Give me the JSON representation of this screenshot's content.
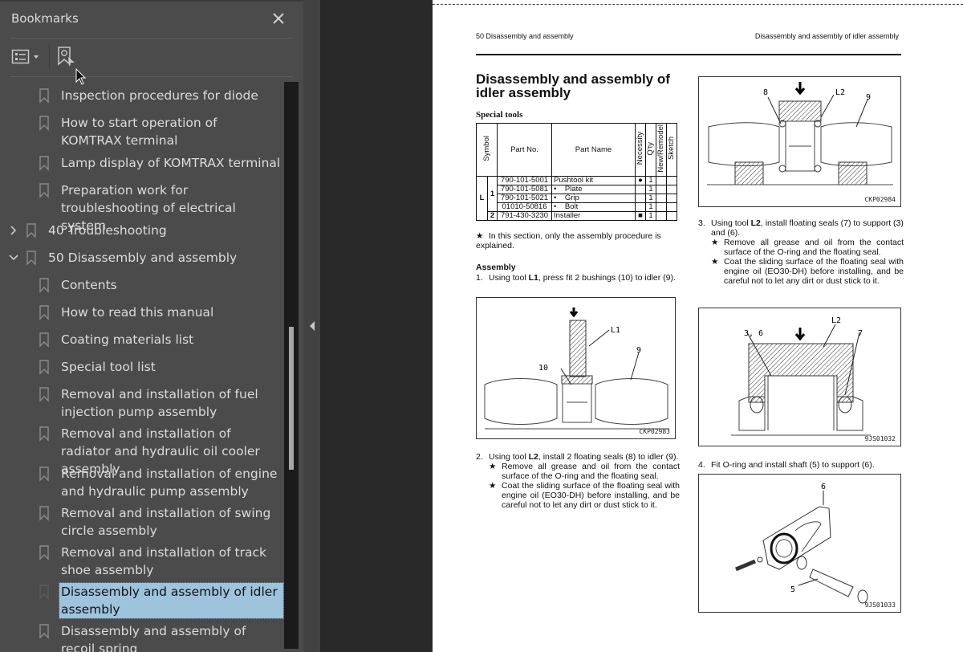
{
  "bookmarks_panel": {
    "title": "Bookmarks",
    "close_icon": "close-icon",
    "toolbar": {
      "options_icon": "list-options-icon",
      "find_icon": "find-current-bookmark-icon"
    },
    "items": [
      {
        "label": "Inspection procedures for diode",
        "level": 2,
        "selected": false
      },
      {
        "label": "How to start operation of KOMTRAX terminal",
        "level": 2,
        "selected": false
      },
      {
        "label": "Lamp display of KOMTRAX terminal",
        "level": 2,
        "selected": false
      },
      {
        "label": "Preparation work for troubleshooting of electrical system",
        "level": 2,
        "selected": false
      },
      {
        "label": "40 Troubleshooting",
        "level": 1,
        "expanded": false,
        "selected": false
      },
      {
        "label": "50 Disassembly and assembly",
        "level": 1,
        "expanded": true,
        "selected": false
      },
      {
        "label": "Contents",
        "level": 2,
        "selected": false
      },
      {
        "label": "How to read this manual",
        "level": 2,
        "selected": false
      },
      {
        "label": "Coating materials list",
        "level": 2,
        "selected": false
      },
      {
        "label": "Special tool list",
        "level": 2,
        "selected": false
      },
      {
        "label": "Removal and installation of fuel injection pump assembly",
        "level": 2,
        "selected": false
      },
      {
        "label": "Removal and installation of radiator and hydraulic oil cooler assembly",
        "level": 2,
        "selected": false
      },
      {
        "label": "Removal and installation of engine and hydraulic pump assembly",
        "level": 2,
        "selected": false
      },
      {
        "label": "Removal and installation of swing circle assembly",
        "level": 2,
        "selected": false
      },
      {
        "label": "Removal and installation of track shoe assembly",
        "level": 2,
        "selected": false
      },
      {
        "label": "Disassembly and assembly of idler assembly",
        "level": 2,
        "selected": true
      },
      {
        "label": "Disassembly and assembly of recoil spring",
        "level": 2,
        "selected": false
      }
    ]
  },
  "document": {
    "header_left": "50 Disassembly and assembly",
    "header_right": "Disassembly and assembly of idler assembly",
    "title": "Disassembly and assembly of idler assembly",
    "special_tools_heading": "Special tools",
    "table": {
      "headers": [
        "Symbol",
        "Part No.",
        "Part Name",
        "Necessity",
        "Q'ty",
        "New/Remodel",
        "Sketch"
      ],
      "rows": [
        {
          "sym": "L",
          "sub": "1",
          "part_no": "790-101-5001",
          "name": "Pushtool kit",
          "necessity": "●",
          "qty": "1"
        },
        {
          "sym": "",
          "sub": "",
          "part_no": "790-101-5081",
          "name": "•    Plate",
          "necessity": "",
          "qty": "1"
        },
        {
          "sym": "",
          "sub": "",
          "part_no": "790-101-5021",
          "name": "•    Grip",
          "necessity": "",
          "qty": "1"
        },
        {
          "sym": "",
          "sub": "",
          "part_no": "01010-50816",
          "name": "•    Bolt",
          "necessity": "",
          "qty": "1"
        },
        {
          "sym": "",
          "sub": "2",
          "part_no": "791-430-3230",
          "name": "Installer",
          "necessity": "■",
          "qty": "1"
        }
      ]
    },
    "note": "In this section, only the assembly procedure is explained.",
    "assembly_heading": "Assembly",
    "steps": [
      {
        "num": "1.",
        "pre": "Using tool ",
        "tool": "L1",
        "post": ", press fit 2 bushings (10) to idler (9).",
        "notes": []
      },
      {
        "num": "2.",
        "pre": "Using tool ",
        "tool": "L2",
        "post": ", install 2 floating seals (8) to idler (9).",
        "notes": [
          "Remove all grease and oil from the contact surface of the O-ring and the floating seal.",
          "Coat the sliding surface of the floating seal with engine oil (EO30-DH) before installing, and be careful not to let any dirt or dust stick to it."
        ]
      },
      {
        "num": "3.",
        "pre": "Using tool ",
        "tool": "L2",
        "post": ", install floating seals (7) to support (3) and (6).",
        "notes": [
          "Remove all grease and oil from the contact surface of the O-ring and the floating seal.",
          "Coat the sliding surface of the floating seal with engine oil (EO30-DH) before installing, and be careful not to let any dirt or dust stick to it."
        ]
      },
      {
        "num": "4.",
        "pre": "Fit O-ring and install shaft (5) to support (6).",
        "tool": "",
        "post": "",
        "notes": []
      }
    ],
    "figures": [
      {
        "code": "CKP02983",
        "labels": [
          "L1",
          "10",
          "9"
        ]
      },
      {
        "code": "CKP02984",
        "labels": [
          "8",
          "L2",
          "9"
        ]
      },
      {
        "code": "9JS01032",
        "labels": [
          "L2",
          "3, 6",
          "7"
        ]
      },
      {
        "code": "9JS01033",
        "labels": [
          "6",
          "5"
        ]
      }
    ],
    "star_glyph": "★"
  }
}
